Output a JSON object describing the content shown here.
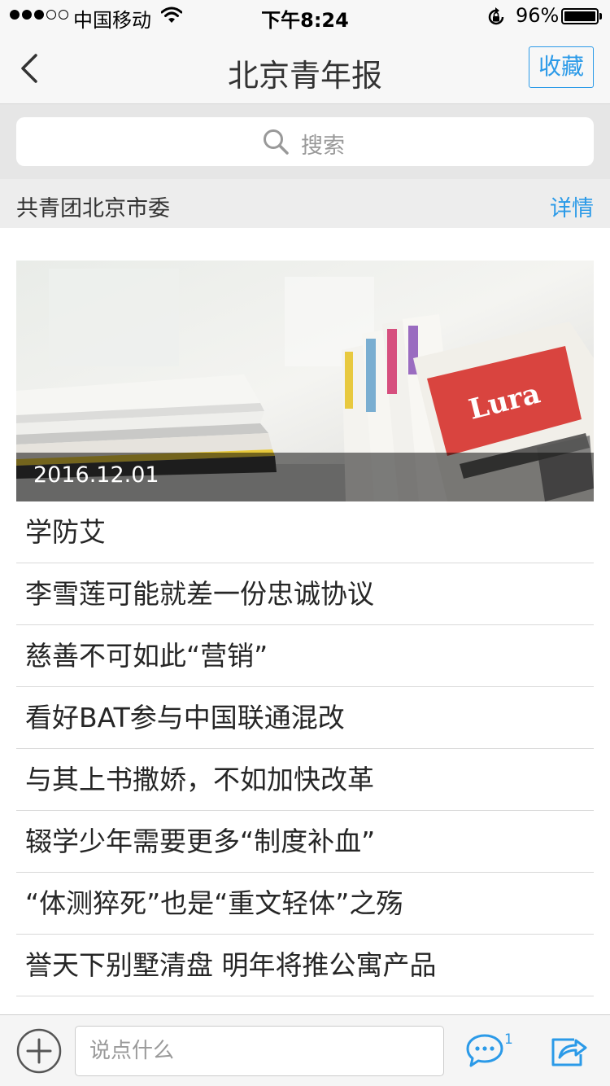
{
  "status_bar": {
    "carrier": "中国移动",
    "time": "下午8:24",
    "battery": "96%",
    "signal_strength": 3,
    "icons": [
      "signal-icon",
      "wifi-icon",
      "rotation-lock-icon",
      "battery-icon"
    ]
  },
  "nav": {
    "back_icon": "chevron-left-icon",
    "title": "北京青年报",
    "favorite_label": "收藏"
  },
  "search": {
    "icon": "search-icon",
    "placeholder": "搜索"
  },
  "org": {
    "name": "共青团北京市委",
    "detail_label": "详情"
  },
  "hero": {
    "date": "2016.12.01"
  },
  "articles": [
    {
      "title": "学防艾"
    },
    {
      "title": "李雪莲可能就差一份忠诚协议"
    },
    {
      "title": "慈善不可如此“营销”"
    },
    {
      "title": "看好BAT参与中国联通混改"
    },
    {
      "title": "与其上书撒娇，不如加快改革"
    },
    {
      "title": "辍学少年需要更多“制度补血”"
    },
    {
      "title": "“体测猝死”也是“重文轻体”之殇"
    },
    {
      "title": "誉天下别墅清盘 明年将推公寓产品"
    }
  ],
  "toolbar": {
    "add_icon": "plus-circle-icon",
    "comment_placeholder": "说点什么",
    "comment_icon": "comment-bubble-icon",
    "comment_count": "1",
    "share_icon": "share-icon"
  },
  "colors": {
    "accent": "#2b9ae8",
    "nav_background": "#f7f7f7",
    "search_background": "#e6e6e6"
  }
}
